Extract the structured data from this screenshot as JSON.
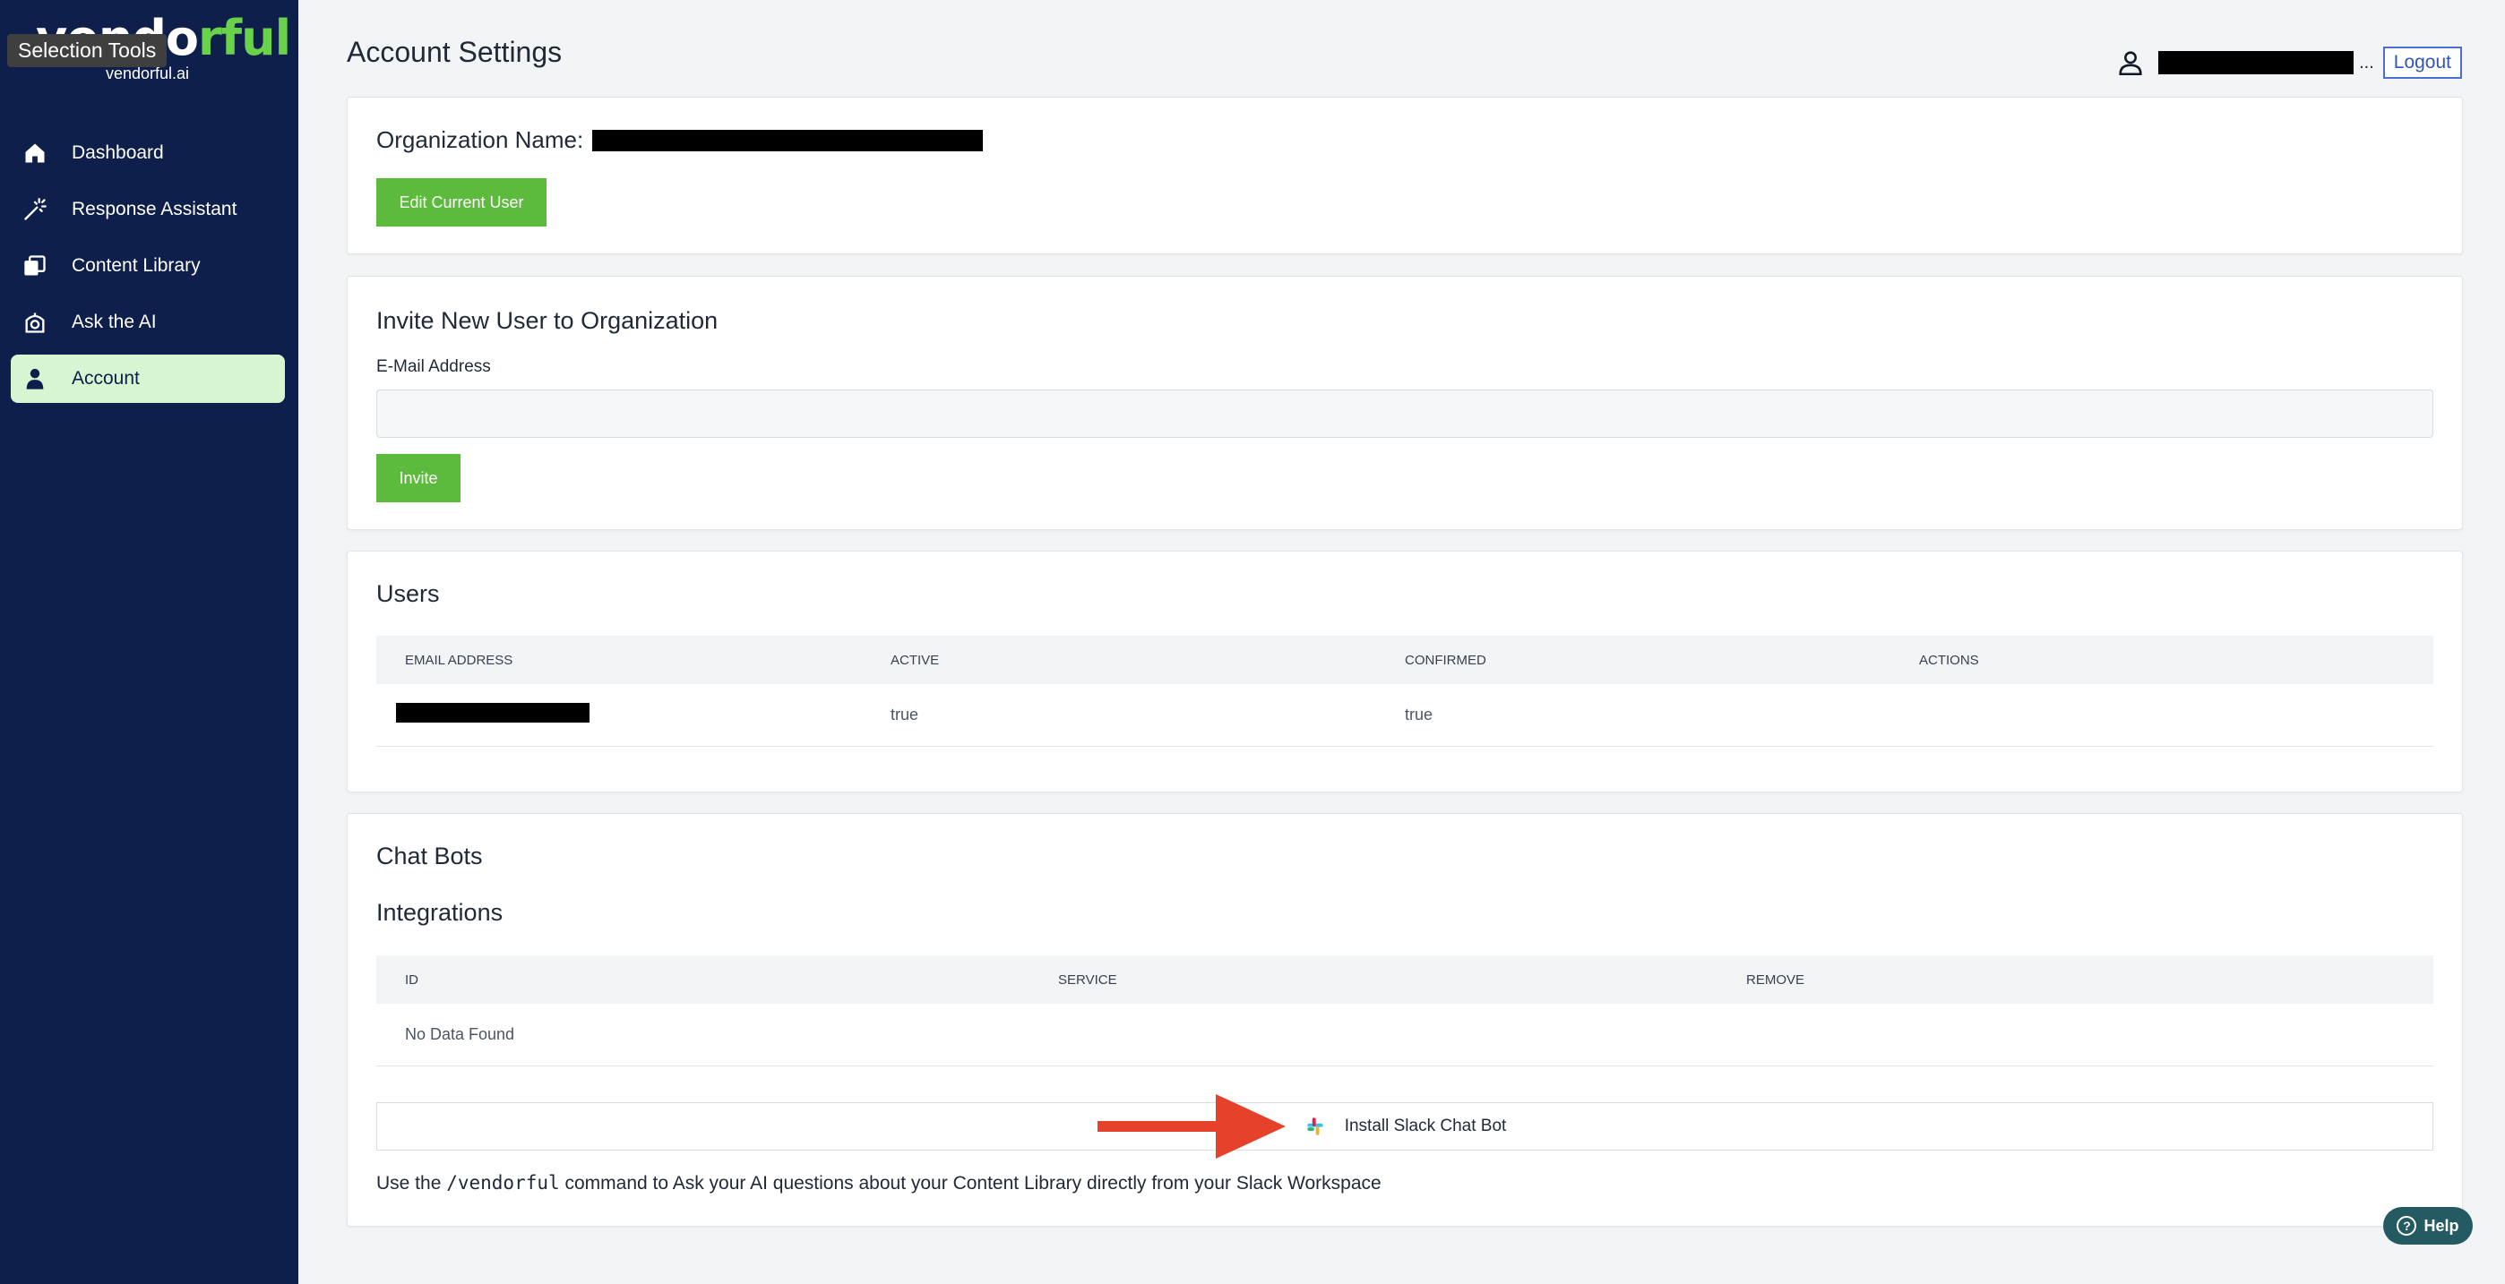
{
  "brand": {
    "logo_part1": "vendo",
    "logo_part2": "rful",
    "logo_sub": "vendorful.ai"
  },
  "tooltip": "Selection Tools",
  "sidebar": {
    "items": [
      {
        "label": "Dashboard",
        "icon": "home-icon"
      },
      {
        "label": "Response Assistant",
        "icon": "magic-wand-icon"
      },
      {
        "label": "Content Library",
        "icon": "library-icon"
      },
      {
        "label": "Ask the AI",
        "icon": "ai-bot-icon"
      },
      {
        "label": "Account",
        "icon": "user-icon",
        "active": true
      }
    ]
  },
  "header": {
    "title": "Account Settings",
    "ellipsis": "...",
    "logout": "Logout"
  },
  "org": {
    "label": "Organization Name:",
    "edit_button": "Edit Current User"
  },
  "invite": {
    "title": "Invite New User to Organization",
    "email_label": "E-Mail Address",
    "email_value": "",
    "button": "Invite"
  },
  "users": {
    "title": "Users",
    "columns": [
      "EMAIL ADDRESS",
      "ACTIVE",
      "CONFIRMED",
      "ACTIONS"
    ],
    "rows": [
      {
        "active": "true",
        "confirmed": "true"
      }
    ]
  },
  "chatbots": {
    "title": "Chat Bots",
    "integrations_title": "Integrations",
    "columns": [
      "ID",
      "SERVICE",
      "REMOVE"
    ],
    "empty": "No Data Found",
    "install_button": "Install Slack Chat Bot",
    "note_before": "Use the ",
    "note_command": "/vendorful",
    "note_after": " command to Ask your AI questions about your Content Library directly from your Slack Workspace"
  },
  "help": {
    "label": "Help"
  },
  "colors": {
    "sidebar": "#0f1f4b",
    "accent_green": "#5cba3c",
    "active_nav": "#d7f5d0",
    "arrow": "#e5412b",
    "help": "#245b63"
  }
}
